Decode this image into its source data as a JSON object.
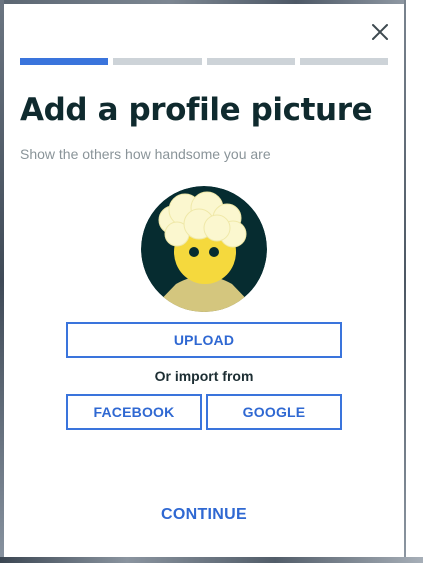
{
  "colors": {
    "accent": "#3a74dc",
    "progress_inactive": "#cdd3d8",
    "title": "#0f2a2e",
    "subtitle": "#8a9499",
    "avatar_background": "#062c30",
    "avatar_face": "#f5d93d",
    "avatar_hair": "#fbf7cf",
    "avatar_body": "#d4c67e"
  },
  "dialog": {
    "close_icon": "close-icon",
    "progress": {
      "total_steps": 4,
      "current_step": 1
    },
    "title": "Add a profile picture",
    "subtitle": "Show the others how handsome you are",
    "avatar_icon": "user-avatar-illustration",
    "upload_label": "UPLOAD",
    "import_label": "Or import from",
    "facebook_label": "FACEBOOK",
    "google_label": "GOOGLE",
    "continue_label": "CONTINUE"
  }
}
